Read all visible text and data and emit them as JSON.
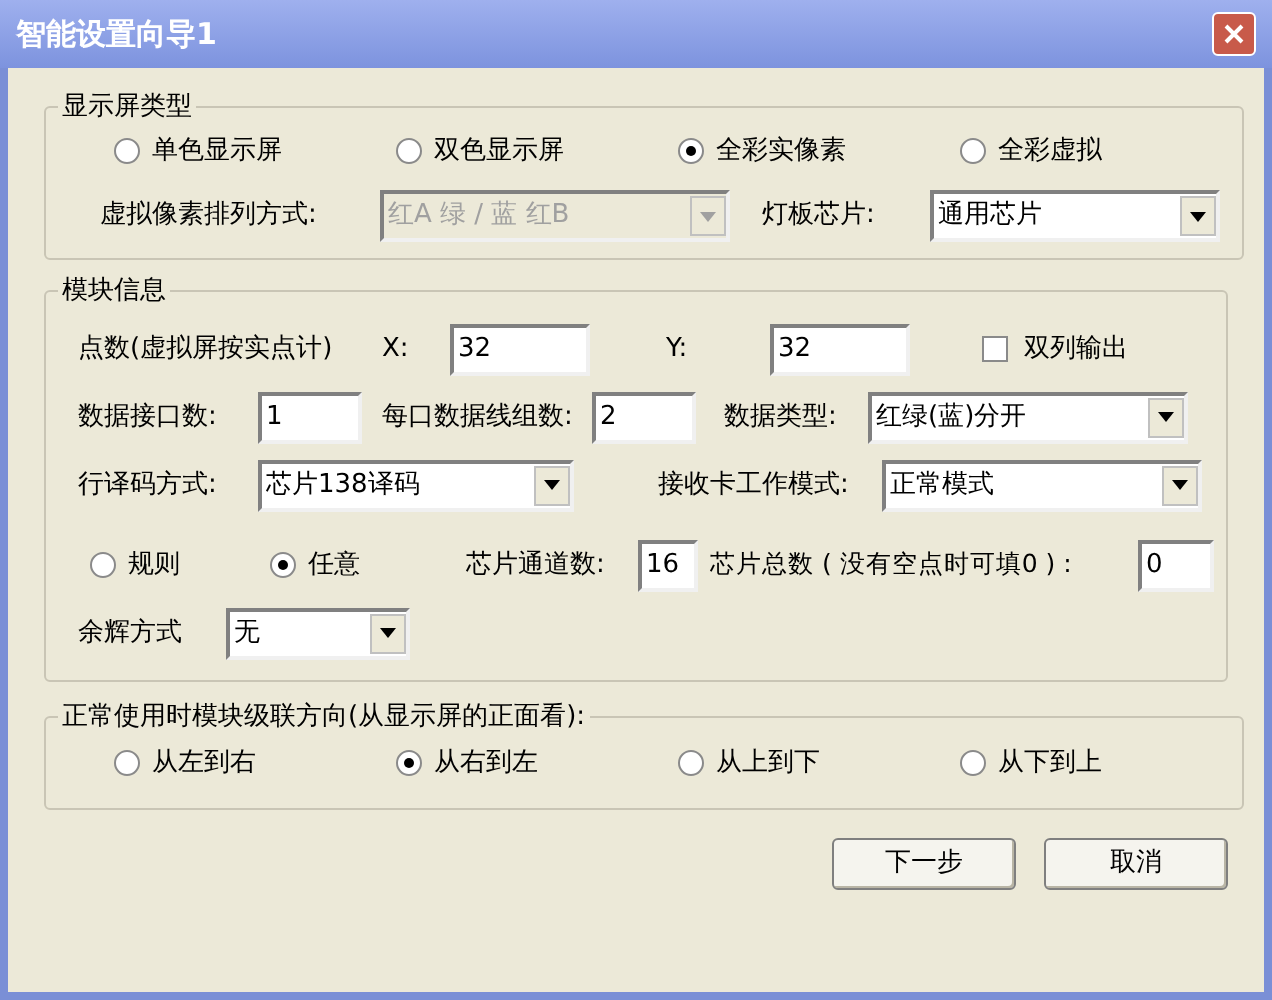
{
  "window": {
    "title": "智能设置向导1"
  },
  "display_type": {
    "legend": "显示屏类型",
    "options": [
      {
        "label": "单色显示屏",
        "selected": false
      },
      {
        "label": "双色显示屏",
        "selected": false
      },
      {
        "label": "全彩实像素",
        "selected": true
      },
      {
        "label": "全彩虚拟",
        "selected": false
      }
    ],
    "pixel_arrangement": {
      "label": "虚拟像素排列方式:",
      "value": "红A 绿 / 蓝 红B",
      "disabled": true
    },
    "panel_chip": {
      "label": "灯板芯片:",
      "value": "通用芯片",
      "disabled": false
    }
  },
  "module_info": {
    "legend": "模块信息",
    "points": {
      "label": "点数(虚拟屏按实点计)",
      "x_label": "X:",
      "x_value": "32",
      "y_label": "Y:",
      "y_value": "32"
    },
    "dual_output": {
      "label": "双列输出",
      "checked": false
    },
    "data_ports": {
      "label": "数据接口数:",
      "value": "1"
    },
    "lines_per_port": {
      "label": "每口数据线组数:",
      "value": "2"
    },
    "data_type": {
      "label": "数据类型:",
      "value": "红绿(蓝)分开",
      "disabled": false
    },
    "row_decode": {
      "label": "行译码方式:",
      "value": "芯片138译码",
      "disabled": false
    },
    "card_mode": {
      "label": "接收卡工作模式:",
      "value": "正常模式",
      "disabled": false
    },
    "layout_options": [
      {
        "label": "规则",
        "selected": false
      },
      {
        "label": "任意",
        "selected": true
      }
    ],
    "chip_channels": {
      "label": "芯片通道数:",
      "value": "16"
    },
    "chip_total": {
      "label": "芯片总数 ( 没有空点时可填0 ) :",
      "value": "0"
    },
    "afterglow": {
      "label": "余辉方式",
      "value": "无",
      "disabled": false
    }
  },
  "cascade": {
    "legend": "正常使用时模块级联方向(从显示屏的正面看):",
    "options": [
      {
        "label": "从左到右",
        "selected": false
      },
      {
        "label": "从右到左",
        "selected": true
      },
      {
        "label": "从上到下",
        "selected": false
      },
      {
        "label": "从下到上",
        "selected": false
      }
    ]
  },
  "buttons": [
    {
      "label": "下一步"
    },
    {
      "label": "取消"
    }
  ]
}
